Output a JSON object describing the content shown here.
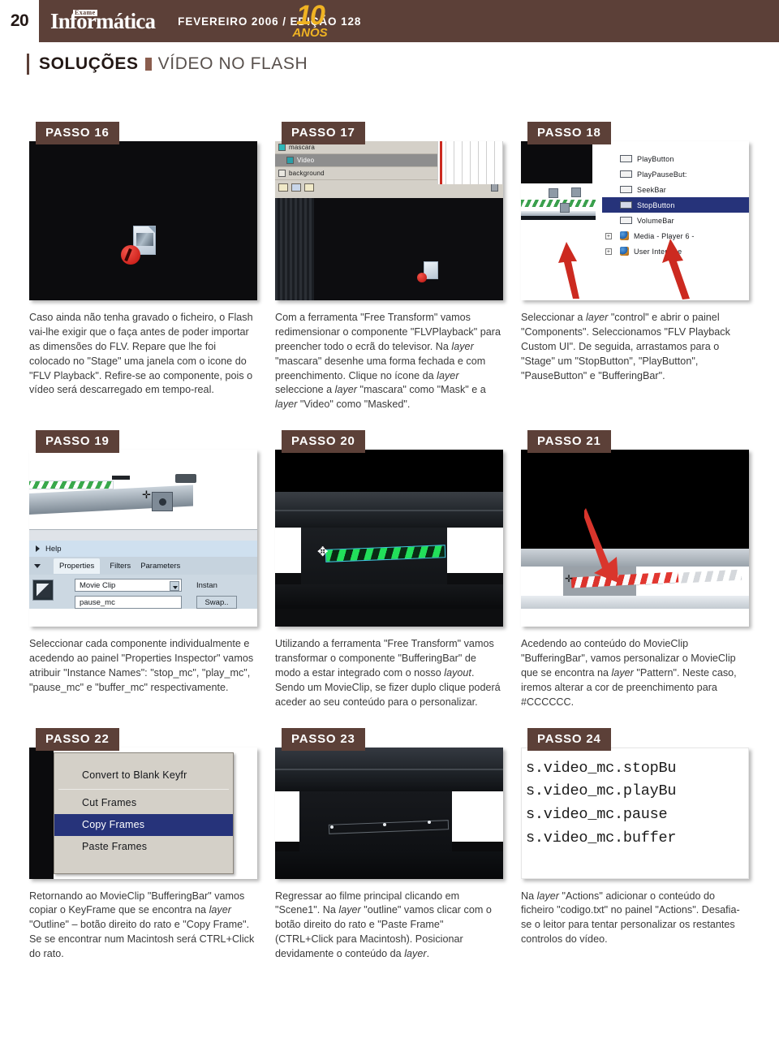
{
  "header": {
    "page_number": "20",
    "logo_superscript": "Exame",
    "logo_main": "Informática",
    "issue": "FEVEREIRO 2006 / EDIÇÃO 128",
    "anniversary_number": "10",
    "anniversary_word": "ANOS"
  },
  "section": {
    "title": "SOLUÇÕES",
    "subtitle": "VÍDEO NO FLASH"
  },
  "colors": {
    "brand_brown": "#5c4038",
    "accent_yellow": "#f0b323",
    "selection_blue": "#26337a",
    "arrow_red": "#cc2a20"
  },
  "steps": [
    {
      "label": "PASSO 16",
      "caption": "Caso ainda não tenha gravado o ficheiro, o Flash vai-lhe exigir que o faça antes de poder importar as dimensões do FLV. Repare que lhe foi colocado no \"Stage\" uma janela com o icone do \"FLV Playback\". Refire-se ao componente, pois o vídeo será descarregado em tempo-real."
    },
    {
      "label": "PASSO 17",
      "caption": "Com a ferramenta \"Free Transform\" vamos redimensionar o componente \"FLVPlayback\" para preencher todo o ecrã do televisor. Na layer \"mascara\" desenhe uma forma fechada e com preenchimento. Clique no ícone da layer seleccione a layer \"mascara\" como \"Mask\" e a layer \"Video\" como \"Masked\".",
      "screenshot": {
        "layers": [
          "mascara",
          "Video",
          "background"
        ],
        "selected_layer": "Video"
      }
    },
    {
      "label": "PASSO 18",
      "caption": "Seleccionar a layer \"control\" e abrir o painel \"Components\". Seleccionamos \"FLV Playback Custom UI\". De seguida, arrastamos para o \"Stage\" um \"StopButton\", \"PlayButton\", \"PauseButton\" e \"BufferingBar\".",
      "screenshot": {
        "components": [
          "PlayButton",
          "PlayPauseBut:",
          "SeekBar",
          "StopButton",
          "VolumeBar"
        ],
        "folders": [
          "Media - Player 6 -",
          "User Interface"
        ],
        "selected_component": "StopButton"
      }
    },
    {
      "label": "PASSO 19",
      "caption": "Seleccionar cada componente individualmente e acedendo ao painel \"Properties Inspector\" vamos atribuir \"Instance Names\": \"stop_mc\", \"play_mc\", \"pause_mc\" e \"buffer_mc\" respectivamente.",
      "screenshot": {
        "help_label": "Help",
        "tabs": [
          "Properties",
          "Filters",
          "Parameters"
        ],
        "active_tab": "Properties",
        "symbol_type": "Movie Clip",
        "instance_label": "Instan",
        "instance_name": "pause_mc",
        "swap_label": "Swap.."
      }
    },
    {
      "label": "PASSO 20",
      "caption": "Utilizando a ferramenta \"Free Transform\" vamos transformar o componente \"BufferingBar\" de modo a estar integrado com o nosso layout. Sendo um MovieClip, se fizer duplo clique poderá aceder ao seu conteúdo para o personalizar."
    },
    {
      "label": "PASSO 21",
      "caption": "Acedendo ao conteúdo do MovieClip \"BufferingBar\", vamos personalizar o MovieClip que se encontra na layer \"Pattern\". Neste caso, iremos alterar a cor de preenchimento para #CCCCCC."
    },
    {
      "label": "PASSO 22",
      "caption": "Retornando ao MovieClip \"BufferingBar\" vamos copiar o KeyFrame que se encontra na layer \"Outline\" – botão direito do rato e \"Copy Frame\". Se se encontrar num Macintosh será CTRL+Click do rato.",
      "screenshot": {
        "menu_items": [
          "Convert to Blank Keyfr",
          "Cut Frames",
          "Copy Frames",
          "Paste Frames"
        ],
        "selected_menu_item": "Copy Frames"
      }
    },
    {
      "label": "PASSO 23",
      "caption": "Regressar ao filme principal clicando em \"Scene1\". Na layer \"outline\" vamos clicar com o botão direito do rato e \"Paste Frame\" (CTRL+Click para Macintosh). Posicionar devidamente o conteúdo da layer."
    },
    {
      "label": "PASSO 24",
      "caption": "Na layer \"Actions\" adicionar o conteúdo do ficheiro \"codigo.txt\" no painel \"Actions\". Desafia-se o leitor para tentar personalizar os restantes controlos do vídeo.",
      "screenshot": {
        "code_lines": [
          "s.video_mc.stopBu",
          "s.video_mc.playBu",
          "s.video_mc.pause",
          "s.video_mc.buffer"
        ]
      }
    }
  ]
}
